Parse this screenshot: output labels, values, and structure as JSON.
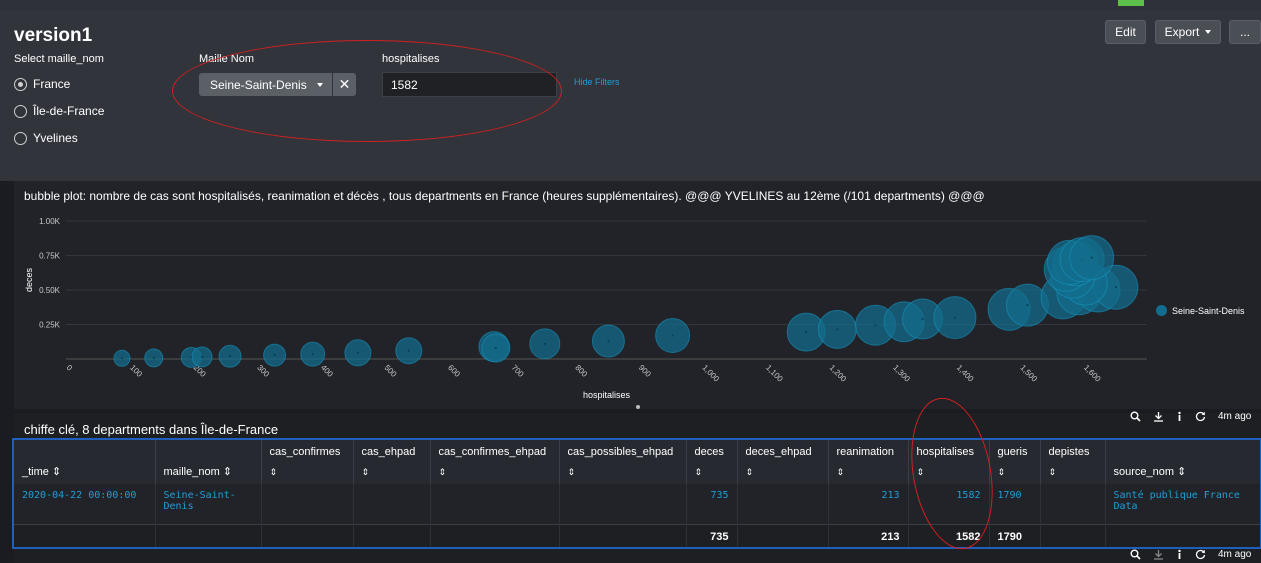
{
  "dashboard": {
    "title": "version1",
    "buttons": {
      "edit": "Edit",
      "export": "Export",
      "more": "..."
    }
  },
  "filters": {
    "radio_label": "Select maille_nom",
    "radio_options": [
      "France",
      "Île-de-France",
      "Yvelines"
    ],
    "radio_selected": "France",
    "maille_label": "Maille Nom",
    "maille_value": "Seine-Saint-Denis",
    "clear_symbol": "✕",
    "hosp_label": "hospitalises",
    "hosp_value": "1582",
    "hide_filters": "Hide Filters"
  },
  "chart_panel": {
    "title": "bubble plot: nombre de cas sont hospitalisés, reanimation et décès , tous departments en France (heures supplémentaires). @@@ YVELINES au 12ème (/101 departments) @@@"
  },
  "chart_data": {
    "type": "scatter",
    "xlabel": "hospitalises",
    "ylabel": "deces",
    "xlim": [
      0,
      1700
    ],
    "ylim": [
      0,
      1000
    ],
    "x_ticks": [
      "0",
      "100",
      "200",
      "300",
      "400",
      "500",
      "600",
      "700",
      "800",
      "900",
      "1,000",
      "1,100",
      "1,200",
      "1,300",
      "1,400",
      "1,500",
      "1,600"
    ],
    "y_ticks": [
      "0.25K",
      "0.50K",
      "0.75K",
      "1.00K"
    ],
    "grid": true,
    "legend_position": "right",
    "series": [
      {
        "name": "Seine-Saint-Denis",
        "color": "#126d8e",
        "points": [
          {
            "x": 88,
            "y": 5,
            "r": 8
          },
          {
            "x": 138,
            "y": 8,
            "r": 9
          },
          {
            "x": 197,
            "y": 12,
            "r": 10
          },
          {
            "x": 214,
            "y": 15,
            "r": 10
          },
          {
            "x": 258,
            "y": 20,
            "r": 11
          },
          {
            "x": 328,
            "y": 28,
            "r": 11
          },
          {
            "x": 388,
            "y": 35,
            "r": 12
          },
          {
            "x": 459,
            "y": 45,
            "r": 13
          },
          {
            "x": 539,
            "y": 60,
            "r": 13
          },
          {
            "x": 673,
            "y": 90,
            "r": 15
          },
          {
            "x": 676,
            "y": 80,
            "r": 14
          },
          {
            "x": 753,
            "y": 110,
            "r": 15
          },
          {
            "x": 853,
            "y": 130,
            "r": 16
          },
          {
            "x": 954,
            "y": 170,
            "r": 17
          },
          {
            "x": 1164,
            "y": 195,
            "r": 19
          },
          {
            "x": 1213,
            "y": 215,
            "r": 19
          },
          {
            "x": 1273,
            "y": 245,
            "r": 20
          },
          {
            "x": 1318,
            "y": 270,
            "r": 20
          },
          {
            "x": 1347,
            "y": 290,
            "r": 20
          },
          {
            "x": 1398,
            "y": 300,
            "r": 21
          },
          {
            "x": 1483,
            "y": 360,
            "r": 21
          },
          {
            "x": 1512,
            "y": 390,
            "r": 21
          },
          {
            "x": 1568,
            "y": 450,
            "r": 22
          },
          {
            "x": 1593,
            "y": 480,
            "r": 22
          },
          {
            "x": 1623,
            "y": 500,
            "r": 22
          },
          {
            "x": 1651,
            "y": 520,
            "r": 22
          },
          {
            "x": 1603,
            "y": 550,
            "r": 22
          },
          {
            "x": 1583,
            "y": 600,
            "r": 22
          },
          {
            "x": 1573,
            "y": 650,
            "r": 22
          },
          {
            "x": 1588,
            "y": 690,
            "r": 22
          },
          {
            "x": 1578,
            "y": 700,
            "r": 22
          },
          {
            "x": 1598,
            "y": 720,
            "r": 22
          },
          {
            "x": 1613,
            "y": 735,
            "r": 22
          }
        ]
      }
    ]
  },
  "table_panel": {
    "title": "chiffe clé, 8 departments dans Île-de-France",
    "age": "4m ago",
    "columns": [
      "_time",
      "maille_nom",
      "cas_confirmes",
      "cas_ehpad",
      "cas_confirmes_ehpad",
      "cas_possibles_ehpad",
      "deces",
      "deces_ehpad",
      "reanimation",
      "hospitalises",
      "gueris",
      "depistes",
      "source_nom"
    ],
    "row": {
      "_time": "2020-04-22 00:00:00",
      "maille_nom": "Seine-Saint-Denis",
      "cas_confirmes": "",
      "cas_ehpad": "",
      "cas_confirmes_ehpad": "",
      "cas_possibles_ehpad": "",
      "deces": "735",
      "deces_ehpad": "",
      "reanimation": "213",
      "hospitalises": "1582",
      "gueris": "1790",
      "depistes": "",
      "source_nom": "Santé publique France Data"
    },
    "totals": {
      "deces": "735",
      "reanimation": "213",
      "hospitalises": "1582",
      "gueris": "1790"
    }
  },
  "icons": [
    "search-icon",
    "download-icon",
    "info-icon",
    "refresh-icon",
    "sort-icon",
    "chevron-down-icon",
    "close-icon"
  ]
}
